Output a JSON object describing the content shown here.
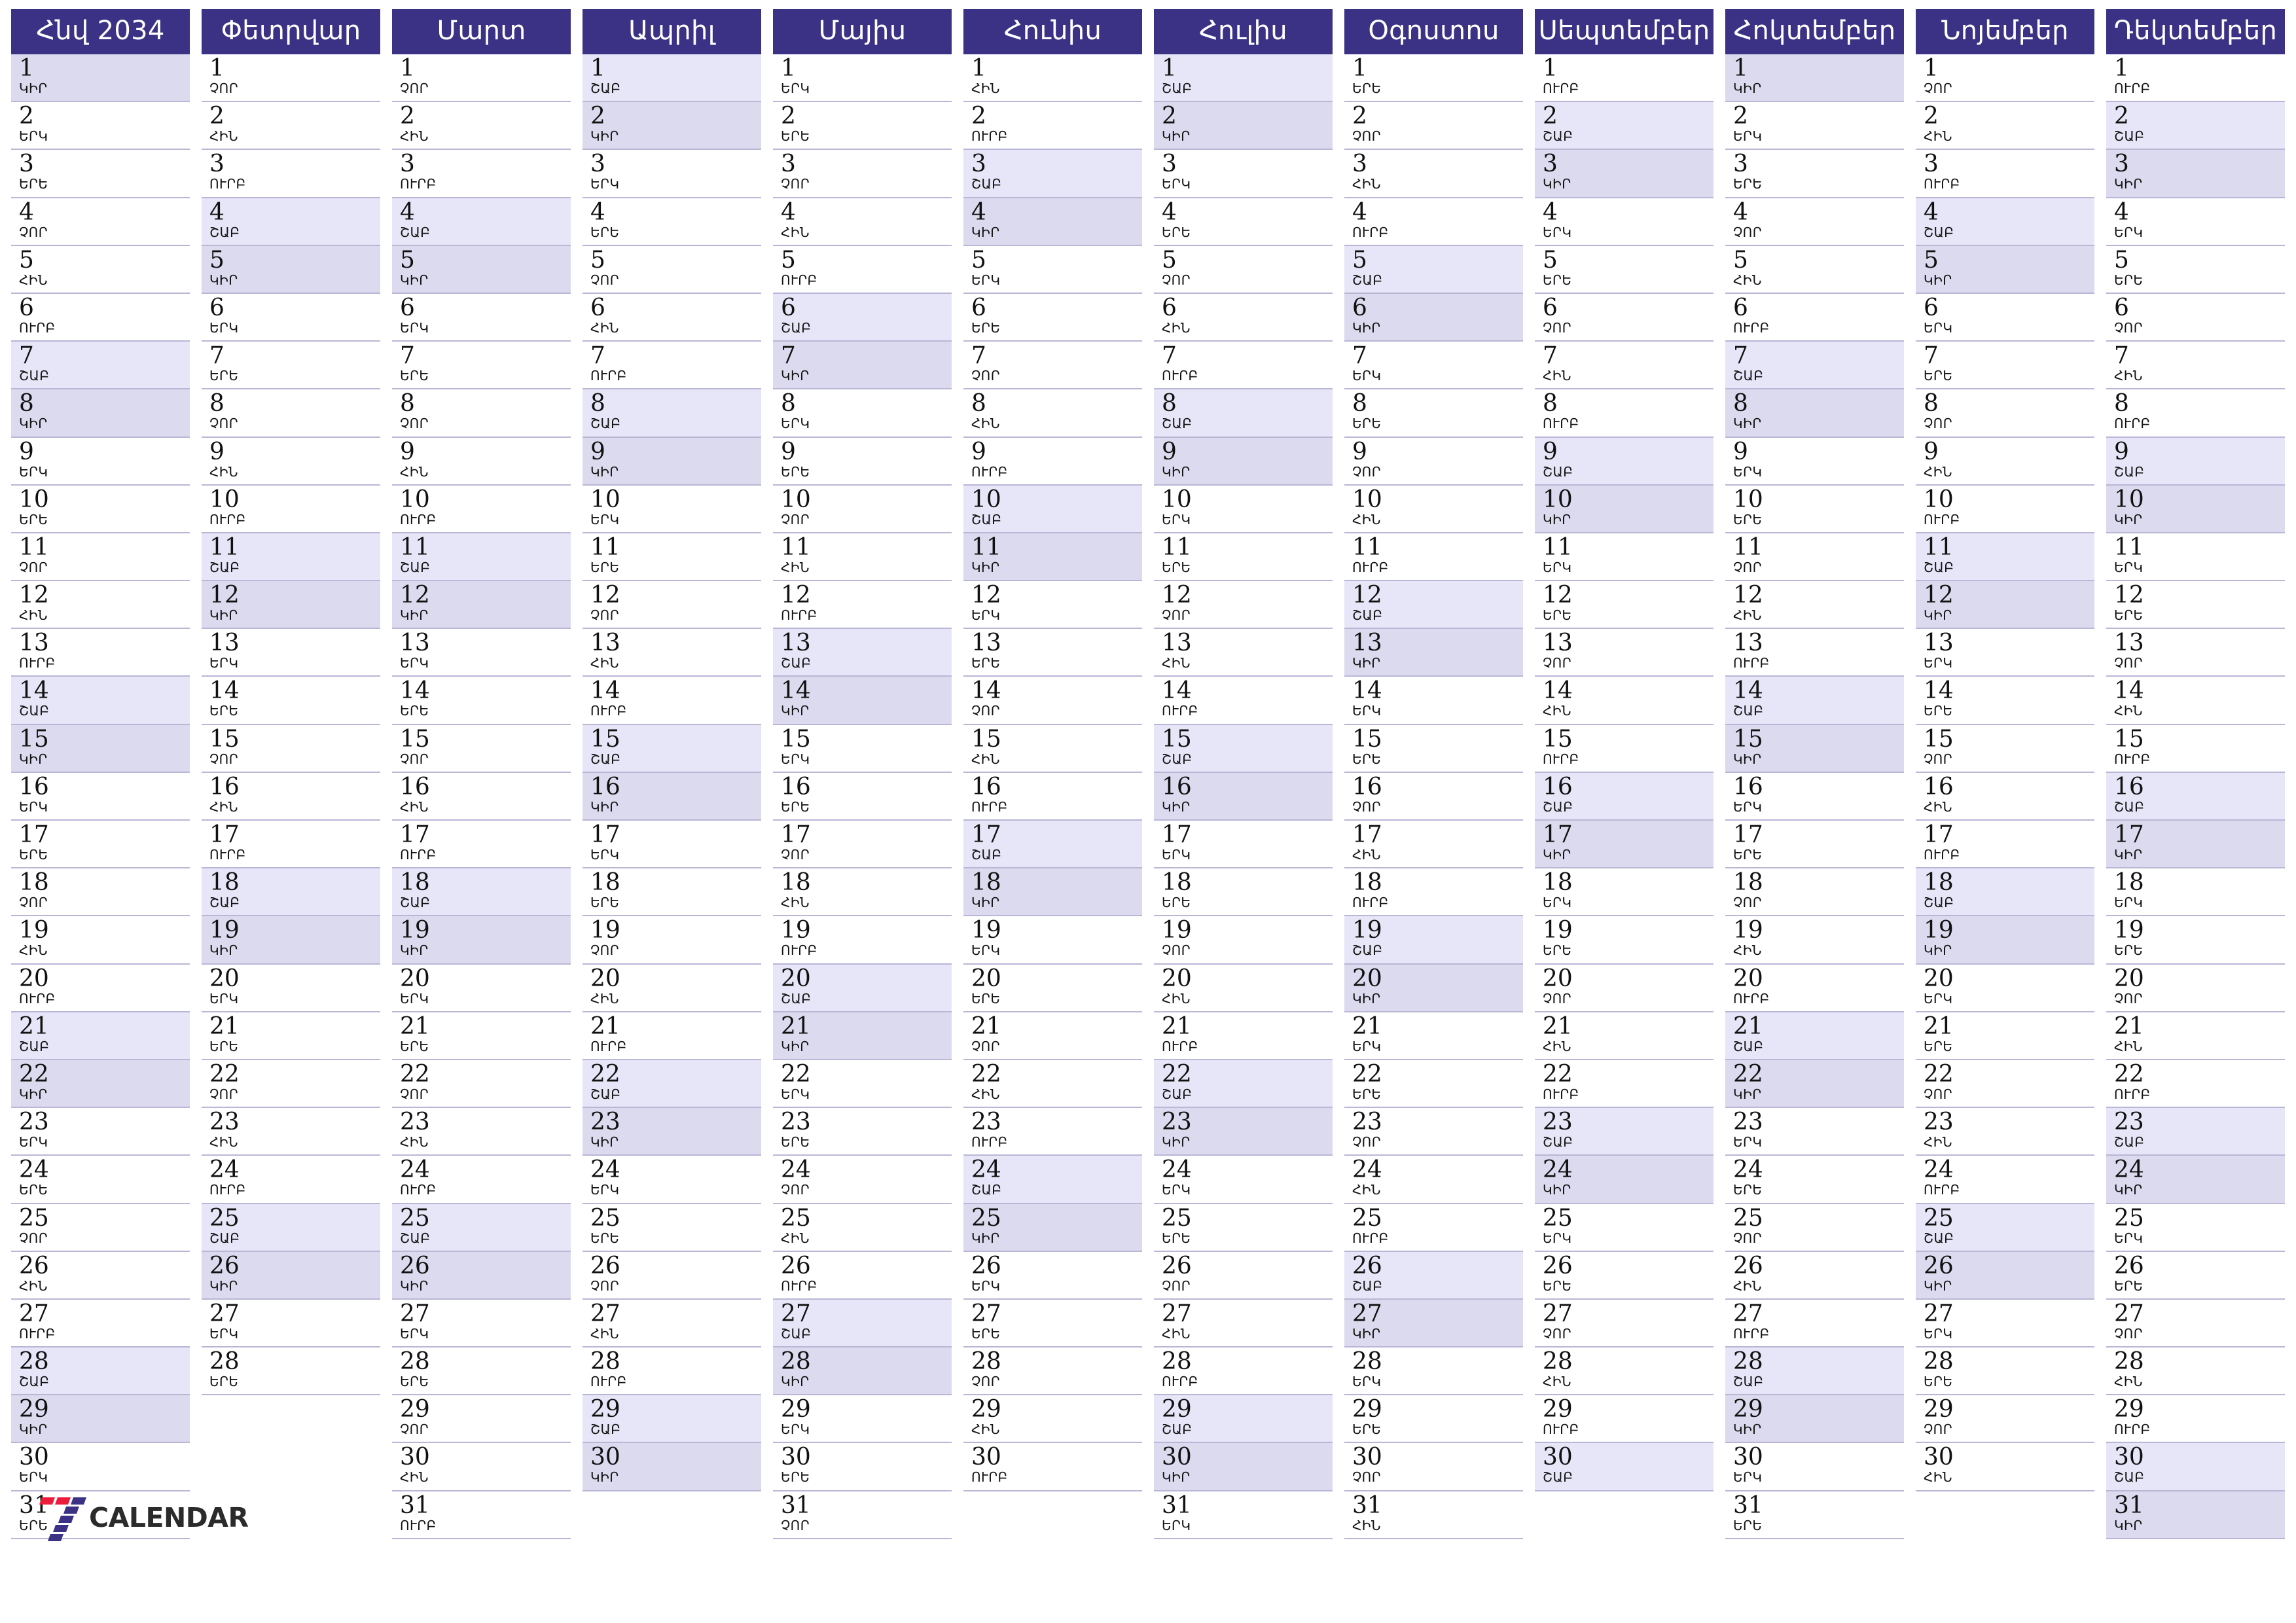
{
  "year": "2034",
  "brand": {
    "logo_icon": "seven-calendar-logo-icon",
    "name": "CALENDAR",
    "accent_red": "#ec1c3c",
    "accent_indigo": "#3b3285"
  },
  "colors": {
    "header_bg": "#3b3285",
    "header_text": "#ffffff",
    "saturday_bg": "#e7e6f8",
    "sunday_bg": "#dcdaee",
    "row_line": "#b9b6d6"
  },
  "weekday_abbrs": {
    "0": "ԿԻՐ",
    "1": "ԵՐԿ",
    "2": "ԵՐԵ",
    "3": "ՉՈՐ",
    "4": "ՀԻՆ",
    "5": "ՈՒՐԲ",
    "6": "ՇԱԲ"
  },
  "months": [
    {
      "name": "Հնվ 2034",
      "days": 31,
      "first_weekday": 0
    },
    {
      "name": "Փետրվար",
      "days": 28,
      "first_weekday": 3
    },
    {
      "name": "Մարտ",
      "days": 31,
      "first_weekday": 3
    },
    {
      "name": "Ապրիլ",
      "days": 30,
      "first_weekday": 6
    },
    {
      "name": "Մայիս",
      "days": 31,
      "first_weekday": 1
    },
    {
      "name": "Հունիս",
      "days": 30,
      "first_weekday": 4
    },
    {
      "name": "Հուլիս",
      "days": 31,
      "first_weekday": 6
    },
    {
      "name": "Օգոստոս",
      "days": 31,
      "first_weekday": 2
    },
    {
      "name": "Սեպտեմբեր",
      "days": 30,
      "first_weekday": 5
    },
    {
      "name": "Հոկտեմբեր",
      "days": 31,
      "first_weekday": 0
    },
    {
      "name": "Նոյեմբեր",
      "days": 30,
      "first_weekday": 3
    },
    {
      "name": "Դեկտեմբեր",
      "days": 31,
      "first_weekday": 5
    }
  ],
  "max_rows": 31
}
